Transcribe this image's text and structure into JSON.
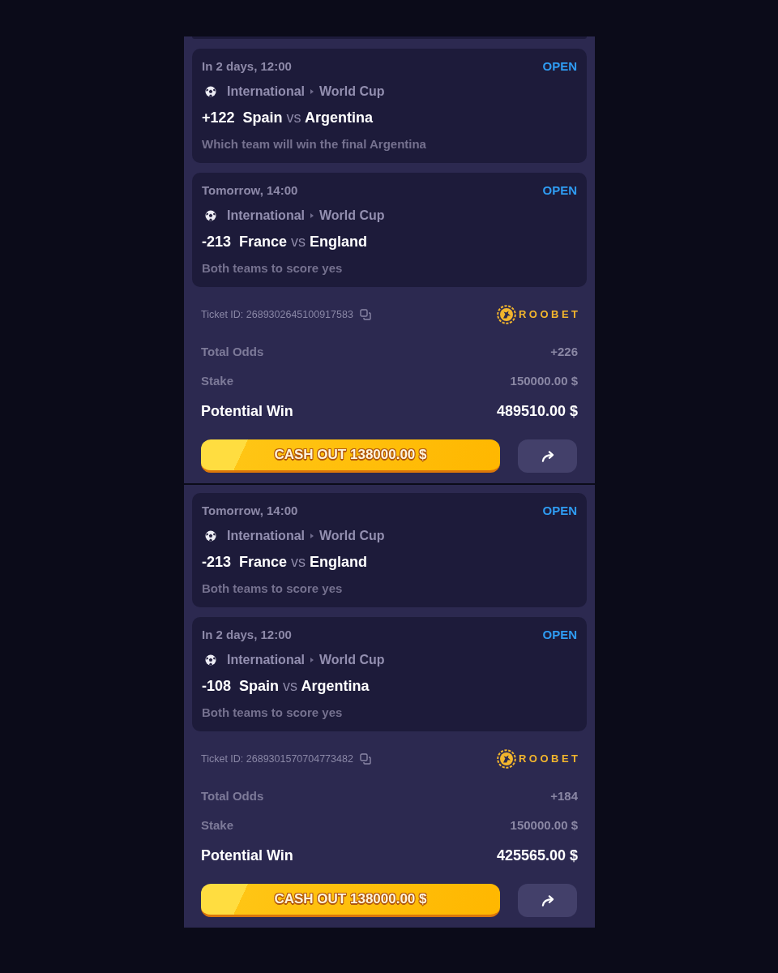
{
  "tickets": [
    {
      "selections": [
        {
          "time": "In 2 days, 12:00",
          "status": "OPEN",
          "category": "International",
          "competition": "World Cup",
          "odds": "+122",
          "home": "Spain",
          "vs": "vs",
          "away": "Argentina",
          "market": "Which team will win the final Argentina"
        },
        {
          "time": "Tomorrow, 14:00",
          "status": "OPEN",
          "category": "International",
          "competition": "World Cup",
          "odds": "-213",
          "home": "France",
          "vs": "vs",
          "away": "England",
          "market": "Both teams to score yes"
        }
      ],
      "ticket_id": "Ticket ID: 2689302645100917583",
      "brand": "ROOBET",
      "summary": [
        {
          "kind": "minor",
          "label": "Total Odds",
          "value": "+226"
        },
        {
          "kind": "minor",
          "label": "Stake",
          "value": "150000.00 $"
        },
        {
          "kind": "major",
          "label": "Potential Win",
          "value": "489510.00 $"
        }
      ],
      "cash_out": "CASH OUT 138000.00 $"
    },
    {
      "selections": [
        {
          "time": "Tomorrow, 14:00",
          "status": "OPEN",
          "category": "International",
          "competition": "World Cup",
          "odds": "-213",
          "home": "France",
          "vs": "vs",
          "away": "England",
          "market": "Both teams to score yes"
        },
        {
          "time": "In 2 days, 12:00",
          "status": "OPEN",
          "category": "International",
          "competition": "World Cup",
          "odds": "-108",
          "home": "Spain",
          "vs": "vs",
          "away": "Argentina",
          "market": "Both teams to score yes"
        }
      ],
      "ticket_id": "Ticket ID: 2689301570704773482",
      "brand": "ROOBET",
      "summary": [
        {
          "kind": "minor",
          "label": "Total Odds",
          "value": "+184"
        },
        {
          "kind": "minor",
          "label": "Stake",
          "value": "150000.00 $"
        },
        {
          "kind": "major",
          "label": "Potential Win",
          "value": "425565.00 $"
        }
      ],
      "cash_out": "CASH OUT 138000.00 $"
    }
  ]
}
